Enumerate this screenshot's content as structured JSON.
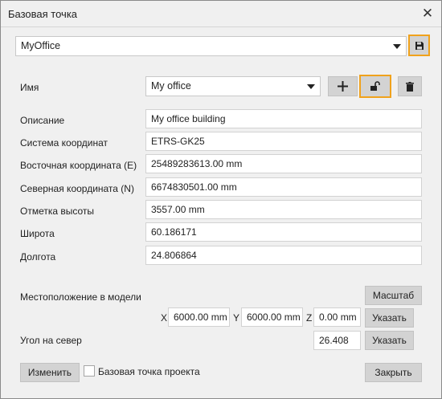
{
  "window": {
    "title": "Базовая точка"
  },
  "top": {
    "selected": "MyOffice",
    "save_icon": "floppy-disk-icon"
  },
  "name_row": {
    "label": "Имя",
    "value": "My office",
    "add_icon": "plus-icon",
    "lock_icon": "unlock-icon",
    "delete_icon": "trash-icon"
  },
  "fields": [
    {
      "label": "Описание",
      "value": "My office building"
    },
    {
      "label": "Система координат",
      "value": "ETRS-GK25"
    },
    {
      "label": "Восточная координата  (E)",
      "value": "25489283613.00 mm"
    },
    {
      "label": "Северная координата  (N)",
      "value": "6674830501.00 mm"
    },
    {
      "label": "Отметка высоты",
      "value": "3557.00 mm"
    },
    {
      "label": "Широта",
      "value": "60.186171"
    },
    {
      "label": "Долгота",
      "value": "24.806864"
    }
  ],
  "model": {
    "label": "Местоположение в модели",
    "scale_button": "Масштаб",
    "x_label": "X",
    "x_value": "6000.00 mm",
    "y_label": "Y",
    "y_value": "6000.00 mm",
    "z_label": "Z",
    "z_value": "0.00 mm",
    "pick_button": "Указать"
  },
  "north": {
    "label": "Угол на север",
    "value": "26.408",
    "pick_button": "Указать"
  },
  "footer": {
    "modify_button": "Изменить",
    "checkbox_label": "Базовая точка проекта",
    "checkbox_checked": false,
    "close_button": "Закрыть"
  },
  "colors": {
    "highlight": "#f0a21c",
    "button": "#d3d3d3",
    "background": "#f0f0f0"
  }
}
